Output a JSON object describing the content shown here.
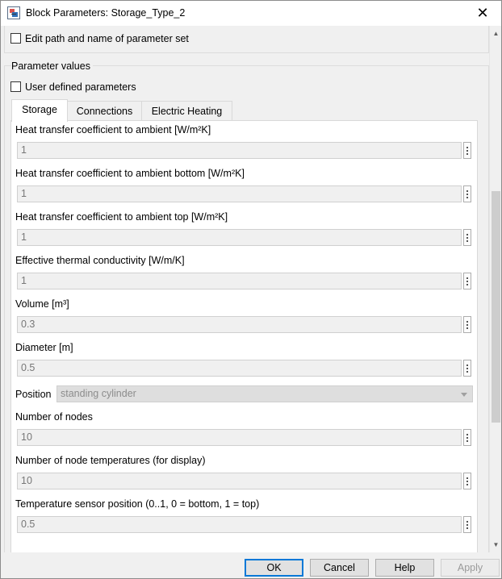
{
  "window": {
    "title": "Block Parameters: Storage_Type_2",
    "close_symbol": "✕"
  },
  "options": {
    "edit_path_label": "Edit path and name of parameter set",
    "edit_path_checked": false,
    "user_defined_label": "User defined parameters",
    "user_defined_checked": false
  },
  "group": {
    "title": "Parameter values"
  },
  "tabs": [
    {
      "label": "Storage",
      "active": true
    },
    {
      "label": "Connections",
      "active": false
    },
    {
      "label": "Electric Heating",
      "active": false
    }
  ],
  "params": [
    {
      "label": "Heat transfer coefficient to ambient [W/m²K]",
      "value": "1"
    },
    {
      "label": "Heat transfer coefficient to ambient bottom [W/m²K]",
      "value": "1"
    },
    {
      "label": "Heat transfer coefficient to ambient top [W/m²K]",
      "value": "1"
    },
    {
      "label": "Effective thermal conductivity [W/m/K]",
      "value": "1"
    },
    {
      "label": "Volume [m³]",
      "value": "0.3"
    },
    {
      "label": "Diameter [m]",
      "value": "0.5"
    },
    {
      "label": "Number of nodes",
      "value": "10"
    },
    {
      "label": "Number of node temperatures (for display)",
      "value": "10"
    },
    {
      "label": "Temperature sensor position (0..1, 0 = bottom, 1 = top)",
      "value": "0.5"
    }
  ],
  "position": {
    "label": "Position",
    "value": "standing cylinder"
  },
  "buttons": {
    "ok": "OK",
    "cancel": "Cancel",
    "help": "Help",
    "apply": "Apply"
  },
  "icons": {
    "app": "block-parameters-icon",
    "close": "close-icon",
    "more": "ellipsis-icon",
    "dropdown": "chevron-down-icon"
  }
}
